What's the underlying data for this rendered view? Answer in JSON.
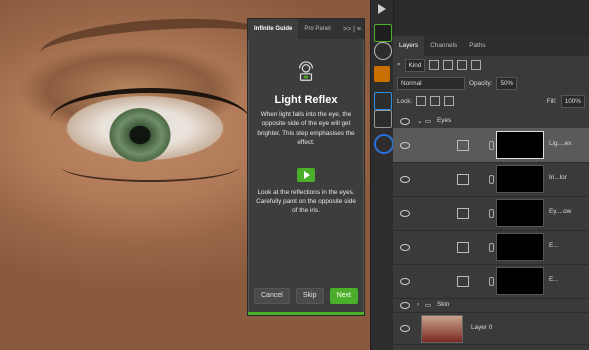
{
  "guide": {
    "tab_active": "Infinite Guide",
    "tab_other": "Pro Panel",
    "controls": ">>  |  ≡",
    "title": "Light Reflex",
    "text1": "When light falls into the eye, the opposite side of the eye will get brighter. This step emphasises the effect.",
    "text2": "Look at the reflections in the eyes. Carefully paint on the opposite side of the iris.",
    "buttons": {
      "cancel": "Cancel",
      "skip": "Skip",
      "next": "Next"
    }
  },
  "layers_panel": {
    "tabs": [
      "Layers",
      "Channels",
      "Paths"
    ],
    "filter_kind": "Kind",
    "blend_mode": "Normal",
    "opacity_label": "Opacity:",
    "opacity_value": "50%",
    "lock_label": "Lock:",
    "fill_label": "Fill:",
    "fill_value": "100%",
    "group_eyes": "Eyes",
    "layers": [
      "Lig....ex",
      "Iri...lor",
      "Ey....ow",
      "E...",
      "E..."
    ],
    "group_skin": "Skin",
    "base_layer": "Layer 0"
  },
  "colors": {
    "accent": "#4caf2a"
  }
}
